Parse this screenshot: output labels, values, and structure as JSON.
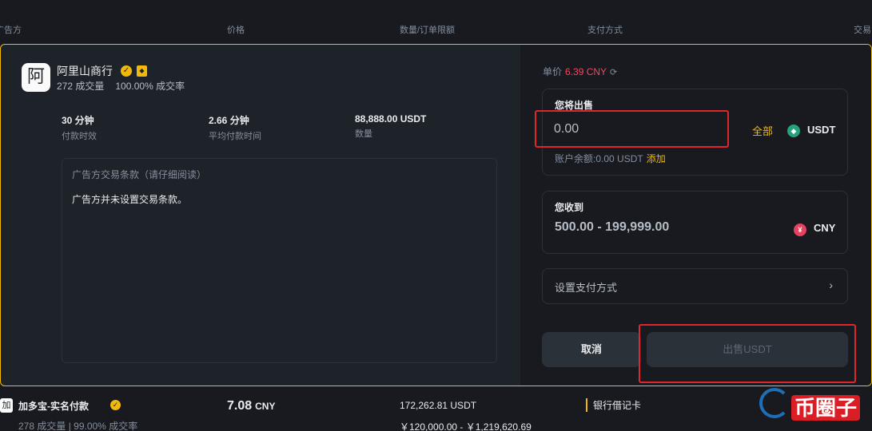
{
  "table_header": {
    "advertiser": "广告方",
    "price": "价格",
    "quantity_limit": "数量/订单限额",
    "payment": "支付方式",
    "trade": "交易"
  },
  "merchant": {
    "avatar_char": "阿",
    "name": "阿里山商行",
    "orders": "272 成交量",
    "completion": "100.00% 成交率",
    "stats": [
      {
        "value": "30 分钟",
        "label": "付款时效"
      },
      {
        "value": "2.66 分钟",
        "label": "平均付款时间"
      },
      {
        "value": "88,888.00 USDT",
        "label": "数量"
      }
    ],
    "terms_title": "广告方交易条款（请仔细阅读）",
    "terms_body": "广告方并未设置交易条款。"
  },
  "order": {
    "unit_price_label": "单价",
    "unit_price": "6.39 CNY",
    "sell_label": "您将出售",
    "sell_placeholder": "0.00",
    "all_label": "全部",
    "sell_coin": "USDT",
    "sell_coin_icon": "tether-icon",
    "balance_text": "账户余额:0.00 USDT",
    "add_label": "添加",
    "receive_label": "您收到",
    "receive_range": "500.00 - 199,999.00",
    "receive_coin": "CNY",
    "receive_coin_icon": "yuan-icon",
    "payment_method_label": "设置支付方式",
    "cancel_label": "取消",
    "sell_button_label": "出售USDT"
  },
  "next_row": {
    "avatar_char": "加",
    "name": "加多宝-实名付款",
    "orders": "278 成交量",
    "completion": "99.00% 成交率",
    "price": "7.08",
    "currency": "CNY",
    "quantity": "172,262.81 USDT",
    "limit": "￥120,000.00 - ￥1,219,620.69",
    "payment": "银行借记卡"
  },
  "watermark": {
    "text": "币圈子"
  },
  "colors": {
    "accent": "#f0b90b",
    "price_red": "#f6465d",
    "highlight_red": "#e0262d",
    "usdt_green": "#26a17b"
  }
}
